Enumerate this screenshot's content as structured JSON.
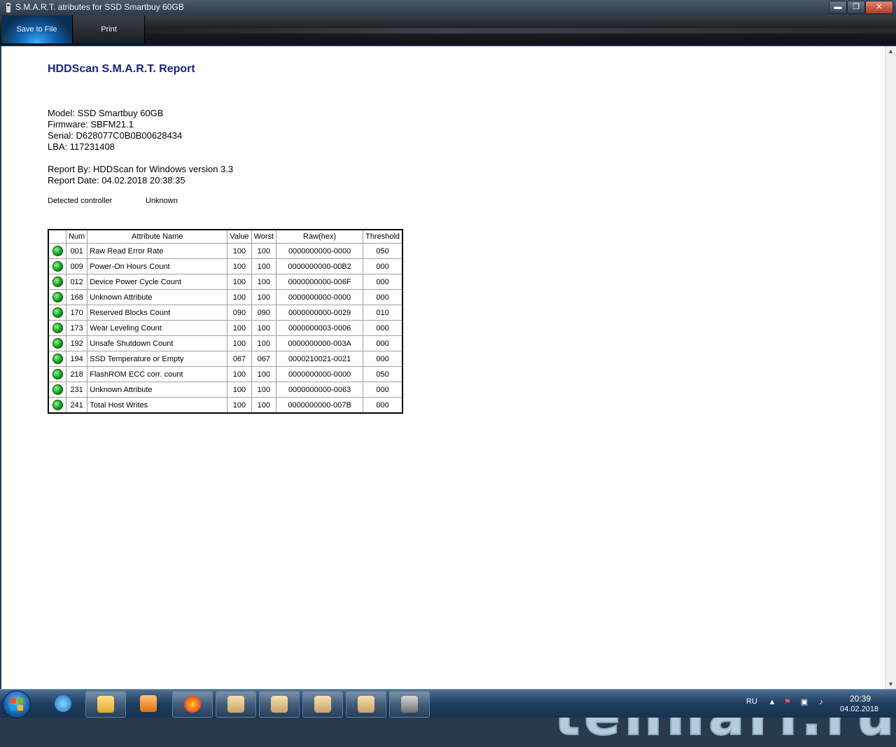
{
  "window": {
    "title": "S.M.A.R.T. atributes for SSD Smartbuy 60GB",
    "minimize": "▬",
    "maximize": "❐",
    "close": "✕"
  },
  "toolbar": {
    "save_label": "Save to File",
    "print_label": "Print"
  },
  "report": {
    "title": "HDDScan S.M.A.R.T. Report",
    "model": "Model: SSD Smartbuy 60GB",
    "firmware": "Firmware: SBFM21.1",
    "serial": "Serial: D628077C0B0B00628434",
    "lba": "LBA: 117231408",
    "report_by": "Report By: HDDScan for Windows version 3.3",
    "report_date": "Report Date: 04.02.2018 20:38:35",
    "controller_label": "Detected controller",
    "controller_value": "Unknown"
  },
  "table": {
    "headers": [
      "",
      "Num",
      "Attribute Name",
      "Value",
      "Worst",
      "Raw(hex)",
      "Threshold"
    ],
    "status_color": "#0e9a1e",
    "rows": [
      {
        "num": "001",
        "name": "Raw Read Error Rate",
        "value": "100",
        "worst": "100",
        "raw": "0000000000-0000",
        "threshold": "050"
      },
      {
        "num": "009",
        "name": "Power-On Hours Count",
        "value": "100",
        "worst": "100",
        "raw": "0000000000-00B2",
        "threshold": "000"
      },
      {
        "num": "012",
        "name": "Device Power Cycle Count",
        "value": "100",
        "worst": "100",
        "raw": "0000000000-006F",
        "threshold": "000"
      },
      {
        "num": "168",
        "name": "Unknown Attribute",
        "value": "100",
        "worst": "100",
        "raw": "0000000000-0000",
        "threshold": "000"
      },
      {
        "num": "170",
        "name": "Reserved Blocks Count",
        "value": "090",
        "worst": "090",
        "raw": "0000000000-0029",
        "threshold": "010"
      },
      {
        "num": "173",
        "name": "Wear Leveling Count",
        "value": "100",
        "worst": "100",
        "raw": "0000000003-0006",
        "threshold": "000"
      },
      {
        "num": "192",
        "name": "Unsafe Shutdown Count",
        "value": "100",
        "worst": "100",
        "raw": "0000000000-003A",
        "threshold": "000"
      },
      {
        "num": "194",
        "name": "SSD Temperature or Empty",
        "value": "067",
        "worst": "067",
        "raw": "0000210021-0021",
        "threshold": "000"
      },
      {
        "num": "218",
        "name": "FlashROM ECC corr. count",
        "value": "100",
        "worst": "100",
        "raw": "0000000000-0000",
        "threshold": "050"
      },
      {
        "num": "231",
        "name": "Unknown Attribute",
        "value": "100",
        "worst": "100",
        "raw": "0000000000-0063",
        "threshold": "000"
      },
      {
        "num": "241",
        "name": "Total Host Writes",
        "value": "100",
        "worst": "100",
        "raw": "0000000000-007B",
        "threshold": "000"
      }
    ]
  },
  "watermark": "tehnari.ru",
  "taskbar": {
    "items": [
      "windows-start",
      "internet-explorer",
      "file-explorer",
      "media-player",
      "firefox",
      "app-avatar-1",
      "app-avatar-2",
      "app-avatar-3",
      "app-avatar-4",
      "hddscan"
    ],
    "language": "RU",
    "time": "20:39",
    "date": "04.02.2018"
  }
}
